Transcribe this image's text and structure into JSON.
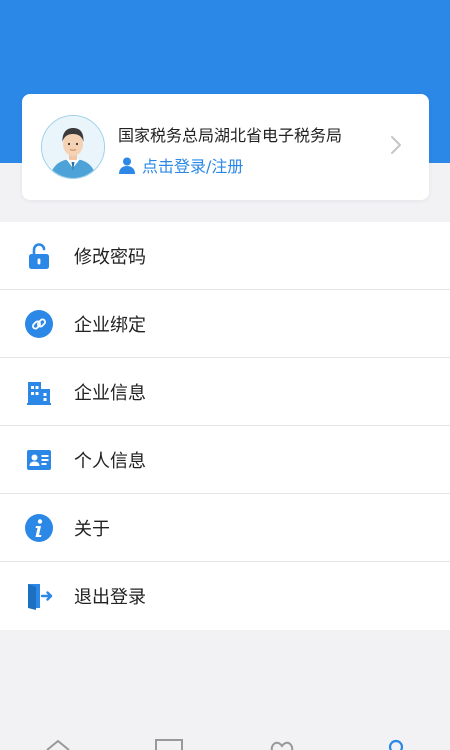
{
  "profile": {
    "title": "国家税务总局湖北省电子税务局",
    "login_text": "点击登录/注册",
    "avatar_icon": "user-avatar-icon",
    "chevron_icon": "chevron-right-icon"
  },
  "menu": {
    "items": [
      {
        "label": "修改密码",
        "icon": "lock-icon"
      },
      {
        "label": "企业绑定",
        "icon": "link-icon"
      },
      {
        "label": "企业信息",
        "icon": "building-icon"
      },
      {
        "label": "个人信息",
        "icon": "id-card-icon"
      },
      {
        "label": "关于",
        "icon": "info-icon"
      },
      {
        "label": "退出登录",
        "icon": "logout-icon"
      }
    ]
  },
  "bottom_nav": {
    "items": [
      {
        "icon": "home-icon"
      },
      {
        "icon": "monitor-icon"
      },
      {
        "icon": "heart-icon"
      },
      {
        "icon": "user-icon"
      }
    ]
  },
  "colors": {
    "accent": "#2b88e6",
    "background": "#f2f1f4"
  }
}
